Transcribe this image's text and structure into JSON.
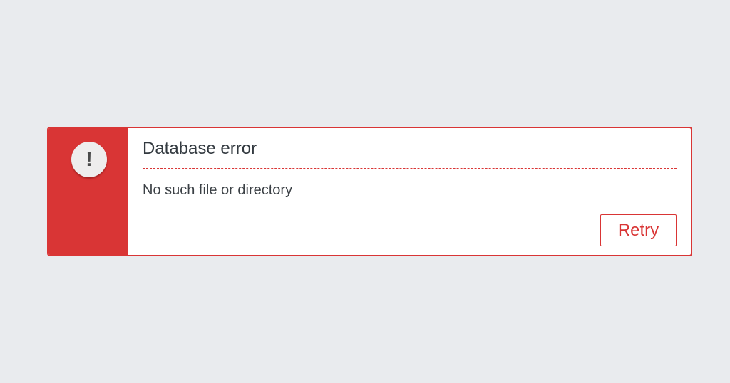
{
  "dialog": {
    "icon": "exclamation-icon",
    "icon_glyph": "!",
    "title": "Database error",
    "message": "No such file or directory",
    "retry_label": "Retry",
    "accent_color": "#d93535",
    "background_color": "#e9ebee"
  }
}
